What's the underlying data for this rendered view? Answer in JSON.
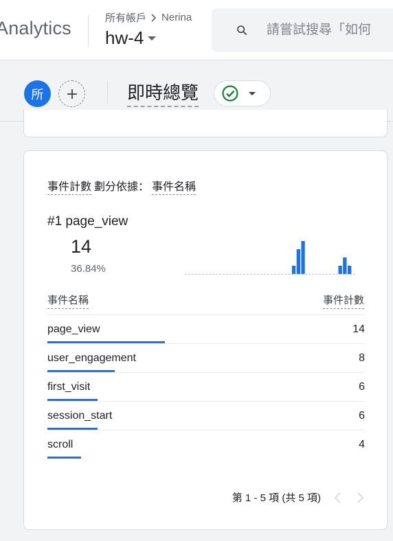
{
  "app": {
    "product_name": "Analytics",
    "breadcrumb": {
      "account": "所有帳戶",
      "sub": "Nerina"
    },
    "property_name": "hw-4",
    "search": {
      "placeholder": "請嘗試搜尋「如何"
    }
  },
  "subheader": {
    "avatar_letter": "所",
    "page_title": "即時總覽"
  },
  "card": {
    "metric_label": "事件計數",
    "dimension_prefix": "劃分依據：",
    "dimension_label": "事件名稱",
    "top_rank": "#1",
    "top_name": "page_view",
    "top_value": "14",
    "top_percent": "36.84%",
    "sparkline_bars": [
      0,
      0,
      0,
      0,
      0,
      0,
      0,
      0,
      0,
      0,
      0,
      0,
      0,
      0,
      0,
      0,
      0,
      0,
      0,
      0,
      0,
      0,
      0,
      1,
      3,
      4,
      0,
      0,
      0,
      0,
      0,
      0,
      0,
      1,
      2,
      1,
      0
    ],
    "col_name": "事件名稱",
    "col_count": "事件計數",
    "rows": [
      {
        "name": "page_view",
        "count": "14",
        "value": 14
      },
      {
        "name": "user_engagement",
        "count": "8",
        "value": 8
      },
      {
        "name": "first_visit",
        "count": "6",
        "value": 6
      },
      {
        "name": "session_start",
        "count": "6",
        "value": 6
      },
      {
        "name": "scroll",
        "count": "4",
        "value": 4
      }
    ],
    "pagination": "第 1 - 5 項 (共 5 項)"
  },
  "colors": {
    "accent": "#1a73e8",
    "success": "#188038"
  }
}
